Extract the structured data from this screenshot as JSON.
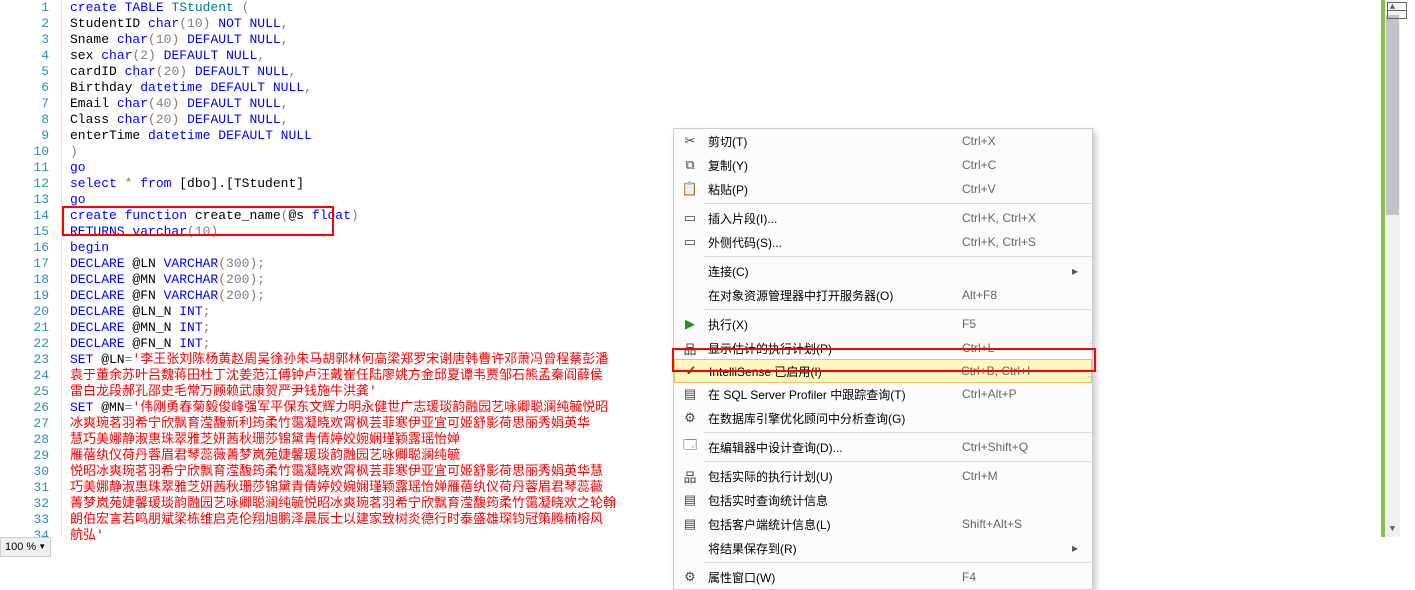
{
  "lines": [
    "1",
    "2",
    "3",
    "4",
    "5",
    "6",
    "7",
    "8",
    "9",
    "10",
    "11",
    "12",
    "13",
    "14",
    "15",
    "16",
    "17",
    "18",
    "19",
    "20",
    "21",
    "22",
    "23",
    "24",
    "25",
    "26",
    "27",
    "28",
    "29",
    "30",
    "31",
    "32",
    "33",
    "34"
  ],
  "code": {
    "l1": {
      "kw1": "create",
      "kw2": "TABLE",
      "name": "TStudent",
      "p1": "("
    },
    "l2": {
      "col": "StudentID",
      "kw": "char",
      "p": "(10)",
      "opt": "NOT NULL",
      "c": ","
    },
    "l3": {
      "col": "Sname",
      "kw": "char",
      "p": "(10)",
      "opt": "DEFAULT NULL",
      "c": ","
    },
    "l4": {
      "col": "sex",
      "kw": "char",
      "p": "(2)",
      "opt": "DEFAULT NULL",
      "c": ","
    },
    "l5": {
      "col": "cardID",
      "kw": "char",
      "p": "(20)",
      "opt": "DEFAULT NULL",
      "c": ","
    },
    "l6": {
      "col": "Birthday",
      "kw": "datetime",
      "opt": "DEFAULT NULL",
      "c": ","
    },
    "l7": {
      "col": "Email",
      "kw": "char",
      "p": "(40)",
      "opt": "DEFAULT NULL",
      "c": ","
    },
    "l8": {
      "col": "Class",
      "kw": "char",
      "p": "(20)",
      "opt": "DEFAULT NULL",
      "c": ","
    },
    "l9": {
      "col": "enterTime",
      "kw": "datetime",
      "opt": "DEFAULT NULL"
    },
    "l10": {
      "p": ")"
    },
    "l11": {
      "kw": "go"
    },
    "l12": {
      "kw": "select",
      "rest": " * ",
      "kw2": "from",
      "obj": " [dbo].[TStudent]"
    },
    "l13": {
      "kw": "go"
    },
    "l14": {
      "kw": "create",
      "kw2": "function",
      "name": " create_name",
      "p1": "(",
      "arg": "@s",
      "typ": " float",
      "p2": ")"
    },
    "l15": {
      "kw": "RETURNS",
      "typ": " varchar",
      "p": "(10)"
    },
    "l16": {
      "kw": "begin"
    },
    "l17": {
      "kw": "DECLARE",
      "var": " @LN",
      "typ": " VARCHAR",
      "p": "(300)",
      ";": ";"
    },
    "l18": {
      "kw": "DECLARE",
      "var": " @MN",
      "typ": " VARCHAR",
      "p": "(200)",
      ";": ";"
    },
    "l19": {
      "kw": "DECLARE",
      "var": " @FN",
      "typ": " VARCHAR",
      "p": "(200)",
      ";": ";"
    },
    "l20": {
      "kw": "DECLARE",
      "var": " @LN_N",
      "typ": " INT",
      ";": ";"
    },
    "l21": {
      "kw": "DECLARE",
      "var": " @MN_N",
      "typ": " INT",
      ";": ";"
    },
    "l22": {
      "kw": "DECLARE",
      "var": " @FN_N",
      "typ": " INT",
      ";": ";"
    },
    "l23": {
      "kw": "SET",
      "var": " @LN",
      "eq": "=",
      "str": "'李王张刘陈杨黄赵周吴徐孙朱马胡郭林何高梁郑罗宋谢唐韩曹许邓萧冯曾程蔡彭潘"
    },
    "l24": {
      "str": "袁于董余苏叶吕魏蒋田杜丁沈姜范江傅钟卢汪戴崔任陆廖姚方金邱夏谭韦贾邹石熊孟秦阎薛侯"
    },
    "l25": {
      "str": "雷白龙段郝孔邵史毛常万顾赖武康贺严尹钱施牛洪龚'"
    },
    "l26": {
      "kw": "SET",
      "var": " @MN",
      "eq": "=",
      "str": "'伟刚勇春菊毅俊峰强军平保东文辉力明永健世广志瑗琰韵融园艺咏卿聪澜纯毓悦昭"
    },
    "l27": {
      "str": "冰爽琬茗羽希宁欣飘育滢馥新利筠柔竹霭凝晓欢霄枫芸菲寒伊亚宜可姬舒影荷思丽秀娟英华"
    },
    "l28": {
      "str": "慧巧美娜静淑惠珠翠雅芝妍茜秋珊莎锦黛青倩婷姣婉娴瑾颖露瑶怡婵"
    },
    "l29": {
      "str": "雁蓓纨仪荷丹蓉眉君琴蕊薇菁梦岚苑婕馨瑗琰韵融园艺咏卿聪澜纯毓"
    },
    "l30": {
      "str": "悦昭冰爽琬茗羽希宁欣飘育滢馥筠柔竹霭凝晓欢霄枫芸菲寒伊亚宜可姬舒影荷思丽秀娟英华慧"
    },
    "l31": {
      "str": "巧美娜静淑惠珠翠雅芝妍茜秋珊莎锦黛青倩婷姣婉娴瑾颖露瑶怡婵雁蓓纨仪荷丹蓉眉君琴蕊薇"
    },
    "l32": {
      "str": "菁梦岚苑婕馨瑗琰韵融园艺咏卿聪澜纯毓悦昭冰爽琬茗羽希宁欣飘育滢馥筠柔竹霭凝晓欢之轮翰"
    },
    "l33": {
      "str": "朗伯宏言若鸣朋斌梁栋维启克伦翔旭鹏泽晨辰士以建家致树炎德行时泰盛雄琛钧冠策腾楠榕风"
    },
    "l34": {
      "str": "航弘'"
    }
  },
  "menu": {
    "cut": {
      "label": "剪切(T)",
      "sc": "Ctrl+X"
    },
    "copy": {
      "label": "复制(Y)",
      "sc": "Ctrl+C"
    },
    "paste": {
      "label": "粘贴(P)",
      "sc": "Ctrl+V"
    },
    "snippet": {
      "label": "插入片段(I)...",
      "sc": "Ctrl+K, Ctrl+X"
    },
    "surround": {
      "label": "外侧代码(S)...",
      "sc": "Ctrl+K, Ctrl+S"
    },
    "conn": {
      "label": "连接(C)"
    },
    "objexp": {
      "label": "在对象资源管理器中打开服务器(O)",
      "sc": "Alt+F8"
    },
    "exec": {
      "label": "执行(X)",
      "sc": "F5"
    },
    "estplan": {
      "label": "显示估计的执行计划(P)",
      "sc": "Ctrl+L"
    },
    "intelli": {
      "label": "IntelliSense 已启用(I)",
      "sc": "Ctrl+B, Ctrl+I"
    },
    "profiler": {
      "label": "在 SQL Server Profiler 中跟踪查询(T)",
      "sc": "Ctrl+Alt+P"
    },
    "tuning": {
      "label": "在数据库引擎优化顾问中分析查询(G)"
    },
    "designq": {
      "label": "在编辑器中设计查询(D)...",
      "sc": "Ctrl+Shift+Q"
    },
    "actplan": {
      "label": "包括实际的执行计划(U)",
      "sc": "Ctrl+M"
    },
    "livestat": {
      "label": "包括实时查询统计信息"
    },
    "clientst": {
      "label": "包括客户端统计信息(L)",
      "sc": "Shift+Alt+S"
    },
    "saveres": {
      "label": "将结果保存到(R)"
    },
    "propwin": {
      "label": "属性窗口(W)",
      "sc": "F4"
    }
  },
  "zoom": {
    "value": "100 %"
  }
}
